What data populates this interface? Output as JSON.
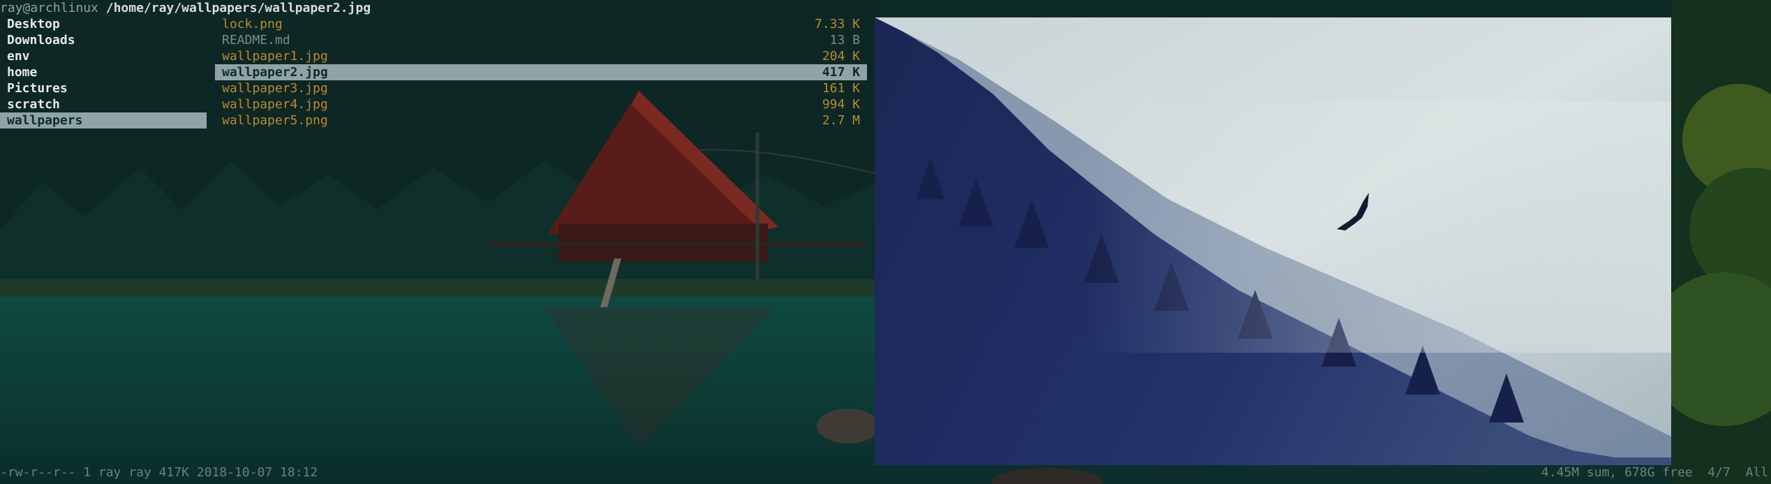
{
  "titlebar": {
    "user_host": "ray@archlinux",
    "path": "/home/ray/wallpapers/wallpaper2.jpg"
  },
  "parent_dirs": [
    {
      "name": "Desktop",
      "selected": false
    },
    {
      "name": "Downloads",
      "selected": false
    },
    {
      "name": "env",
      "selected": false
    },
    {
      "name": "home",
      "selected": false
    },
    {
      "name": "Pictures",
      "selected": false
    },
    {
      "name": "scratch",
      "selected": false
    },
    {
      "name": "wallpapers",
      "selected": true
    }
  ],
  "files": [
    {
      "name": "lock.png",
      "size": "7.33 K",
      "selected": false
    },
    {
      "name": "README.md",
      "size": "13 B",
      "selected": false
    },
    {
      "name": "wallpaper1.jpg",
      "size": "204 K",
      "selected": false
    },
    {
      "name": "wallpaper2.jpg",
      "size": "417 K",
      "selected": true
    },
    {
      "name": "wallpaper3.jpg",
      "size": "161 K",
      "selected": false
    },
    {
      "name": "wallpaper4.jpg",
      "size": "994 K",
      "selected": false
    },
    {
      "name": "wallpaper5.png",
      "size": "2.7 M",
      "selected": false
    }
  ],
  "preview": {
    "icon": "image-preview-foggy-forest-eagle"
  },
  "statusbar": {
    "left": "-rw-r--r-- 1 ray ray 417K 2018-10-07 18:12",
    "right": "4.45M sum, 678G free  4/7  All"
  },
  "colors": {
    "selection_bg": "#8fa3a8",
    "file_fg": "#b98a2f",
    "dir_fg": "#e4e8e8"
  }
}
